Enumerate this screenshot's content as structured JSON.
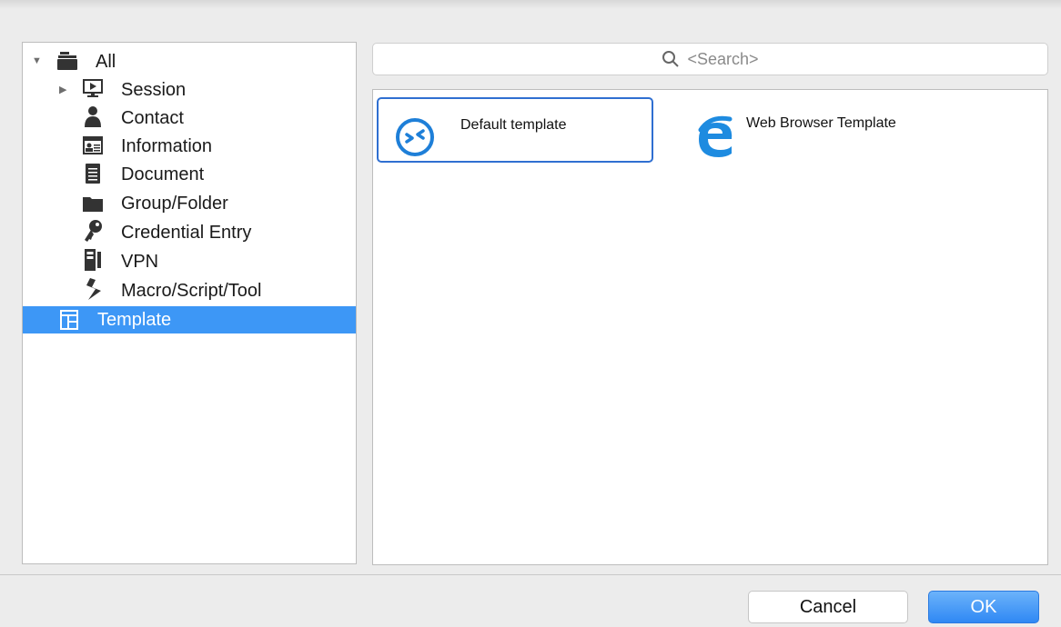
{
  "tree": {
    "items": [
      {
        "label": "All",
        "icon": "folder-stack-icon",
        "expanded": true
      },
      {
        "label": "Session",
        "icon": "monitor-play-icon",
        "expanded": false
      },
      {
        "label": "Contact",
        "icon": "person-icon"
      },
      {
        "label": "Information",
        "icon": "id-card-icon"
      },
      {
        "label": "Document",
        "icon": "document-icon"
      },
      {
        "label": "Group/Folder",
        "icon": "folder-icon"
      },
      {
        "label": "Credential Entry",
        "icon": "key-icon"
      },
      {
        "label": "VPN",
        "icon": "server-icon"
      },
      {
        "label": "Macro/Script/Tool",
        "icon": "script-icon"
      },
      {
        "label": "Template",
        "icon": "template-icon",
        "selected": true
      }
    ]
  },
  "search": {
    "placeholder": "<Search>"
  },
  "templates": [
    {
      "label": "Default template",
      "icon": "remote-desktop-icon",
      "selected": true
    },
    {
      "label": "Web Browser Template",
      "icon": "internet-explorer-icon",
      "selected": false
    }
  ],
  "buttons": {
    "cancel": "Cancel",
    "ok": "OK"
  },
  "colors": {
    "selection": "#3d97f6",
    "tile_border": "#2f6fd1",
    "ok_button": "#2f88f4",
    "ie_blue": "#1e8be0"
  }
}
